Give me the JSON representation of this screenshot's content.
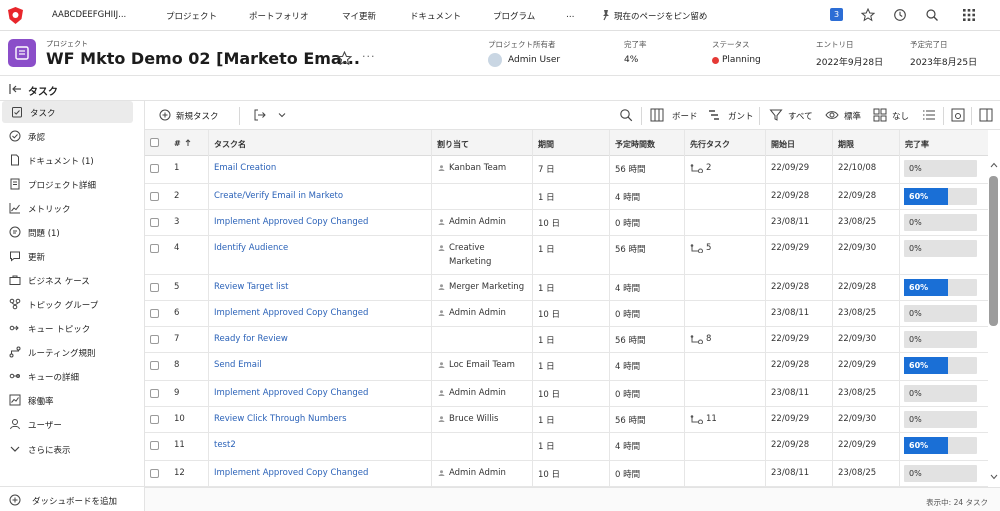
{
  "topnav": {
    "workspace": "AABCDEEFGHIIJ...",
    "items": [
      "プロジェクト",
      "ポートフォリオ",
      "マイ更新",
      "ドキュメント",
      "プログラム",
      "…"
    ],
    "pin_label": "現在のページをピン留め",
    "notification_count": "3"
  },
  "project": {
    "label": "プロジェクト",
    "title": "WF Mkto Demo 02 [Marketo Ema...",
    "owner_label": "プロジェクト所有者",
    "owner": "Admin User",
    "complete_label": "完了率",
    "complete": "4%",
    "status_label": "ステータス",
    "status": "Planning",
    "entry_label": "エントリ日",
    "entry": "2022年9月28日",
    "planned_label": "予定完了日",
    "planned": "2023年8月25日",
    "status_color": "#e53935",
    "icon_color": "#8b4ec9"
  },
  "section_title": "タスク",
  "sidebar": {
    "items": [
      {
        "label": "タスク",
        "icon": "task-icon"
      },
      {
        "label": "承認",
        "icon": "approval-icon"
      },
      {
        "label": "ドキュメント (1)",
        "icon": "document-icon"
      },
      {
        "label": "プロジェクト詳細",
        "icon": "details-icon"
      },
      {
        "label": "メトリック",
        "icon": "metric-icon"
      },
      {
        "label": "問題 (1)",
        "icon": "issue-icon"
      },
      {
        "label": "更新",
        "icon": "update-icon"
      },
      {
        "label": "ビジネス ケース",
        "icon": "business-case-icon"
      },
      {
        "label": "トピック グループ",
        "icon": "topic-group-icon"
      },
      {
        "label": "キュー トピック",
        "icon": "queue-topic-icon"
      },
      {
        "label": "ルーティング規則",
        "icon": "routing-icon"
      },
      {
        "label": "キューの詳細",
        "icon": "queue-details-icon"
      },
      {
        "label": "稼働率",
        "icon": "utilization-icon"
      },
      {
        "label": "ユーザー",
        "icon": "users-icon"
      }
    ],
    "more": "さらに表示",
    "add_dashboard": "ダッシュボードを追加"
  },
  "toolbar": {
    "new_task": "新規タスク",
    "board": "ボード",
    "gantt": "ガント",
    "filter": "すべて",
    "view": "標準",
    "group": "なし"
  },
  "table": {
    "columns": [
      "#",
      "タスク名",
      "割り当て",
      "期間",
      "予定時間数",
      "先行タスク",
      "開始日",
      "期限",
      "完了率"
    ],
    "rows": [
      {
        "num": "1",
        "name": "Email Creation",
        "assign": "Kanban Team",
        "assign2": "",
        "dur": "7 日",
        "hours": "56 時間",
        "pred": "2",
        "start": "22/09/29",
        "due": "22/10/08",
        "pct": "0%",
        "fill": 0
      },
      {
        "num": "2",
        "name": "Create/Verify Email in Marketo",
        "assign": "",
        "assign2": "",
        "dur": "1 日",
        "hours": "4 時間",
        "pred": "",
        "start": "22/09/28",
        "due": "22/09/28",
        "pct": "60%",
        "fill": 0.6
      },
      {
        "num": "3",
        "name": "Implement Approved Copy Changed",
        "assign": "Admin Admin",
        "assign2": "",
        "dur": "10 日",
        "hours": "0 時間",
        "pred": "",
        "start": "23/08/11",
        "due": "23/08/25",
        "pct": "0%",
        "fill": 0
      },
      {
        "num": "4",
        "name": "Identify Audience",
        "assign": "Creative",
        "assign2": "Marketing",
        "dur": "1 日",
        "hours": "56 時間",
        "pred": "5",
        "start": "22/09/29",
        "due": "22/09/30",
        "pct": "0%",
        "fill": 0
      },
      {
        "num": "5",
        "name": "Review Target list",
        "assign": "Merger Marketing",
        "assign2": "",
        "dur": "1 日",
        "hours": "4 時間",
        "pred": "",
        "start": "22/09/28",
        "due": "22/09/28",
        "pct": "60%",
        "fill": 0.6
      },
      {
        "num": "6",
        "name": "Implement Approved Copy Changed",
        "assign": "Admin Admin",
        "assign2": "",
        "dur": "10 日",
        "hours": "0 時間",
        "pred": "",
        "start": "23/08/11",
        "due": "23/08/25",
        "pct": "0%",
        "fill": 0
      },
      {
        "num": "7",
        "name": "Ready for Review",
        "assign": "",
        "assign2": "",
        "dur": "1 日",
        "hours": "56 時間",
        "pred": "8",
        "start": "22/09/29",
        "due": "22/09/30",
        "pct": "0%",
        "fill": 0
      },
      {
        "num": "8",
        "name": "Send Email",
        "assign": "Loc Email Team",
        "assign2": "",
        "dur": "1 日",
        "hours": "4 時間",
        "pred": "",
        "start": "22/09/28",
        "due": "22/09/29",
        "pct": "60%",
        "fill": 0.6
      },
      {
        "num": "9",
        "name": "Implement Approved Copy Changed",
        "assign": "Admin Admin",
        "assign2": "",
        "dur": "10 日",
        "hours": "0 時間",
        "pred": "",
        "start": "23/08/11",
        "due": "23/08/25",
        "pct": "0%",
        "fill": 0
      },
      {
        "num": "10",
        "name": "Review Click Through Numbers",
        "assign": "Bruce Willis",
        "assign2": "",
        "dur": "1 日",
        "hours": "56 時間",
        "pred": "11",
        "start": "22/09/29",
        "due": "22/09/30",
        "pct": "0%",
        "fill": 0
      },
      {
        "num": "11",
        "name": "test2",
        "assign": "",
        "assign2": "",
        "dur": "1 日",
        "hours": "4 時間",
        "pred": "",
        "start": "22/09/28",
        "due": "22/09/29",
        "pct": "60%",
        "fill": 0.6
      },
      {
        "num": "12",
        "name": "Implement Approved Copy Changed",
        "assign": "Admin Admin",
        "assign2": "",
        "dur": "10 日",
        "hours": "0 時間",
        "pred": "",
        "start": "23/08/11",
        "due": "23/08/25",
        "pct": "0%",
        "fill": 0
      }
    ]
  },
  "status_text": "表示中: 24 タスク"
}
